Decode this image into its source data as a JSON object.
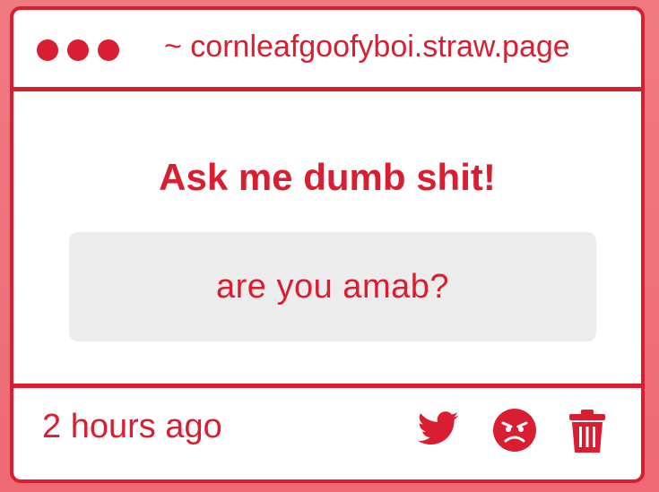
{
  "window": {
    "url": "~ cornleafgoofyboi.straw.page"
  },
  "content": {
    "heading": "Ask me dumb shit!",
    "question": "are you amab?"
  },
  "footer": {
    "timestamp": "2 hours ago",
    "actions": [
      "twitter-icon",
      "angry-face-icon",
      "trash-icon"
    ]
  },
  "colors": {
    "accent": "#d81e30",
    "background": "#ee6a74",
    "card": "#ffffff",
    "question_box": "#ececec"
  }
}
